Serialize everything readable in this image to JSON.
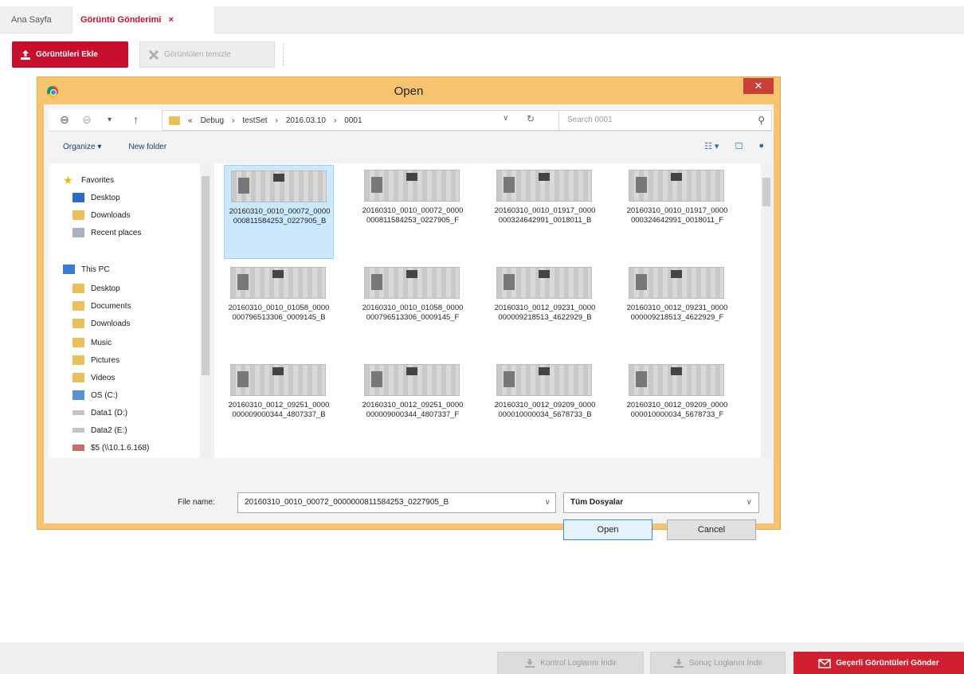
{
  "tabs": [
    {
      "label": "Ana Sayfa"
    },
    {
      "label": "Görüntü Gönderimi",
      "close": "×"
    }
  ],
  "toolbar": {
    "upload_label": "Görüntüleri Ekle",
    "clear_label": "Görüntüleri temizle"
  },
  "dialog": {
    "title": "Open",
    "close": "✕",
    "address": {
      "crumbs": [
        "«",
        "Debug",
        "›",
        "testSet",
        "›",
        "2016.03.10",
        "›",
        "0001"
      ],
      "search_placeholder": "Search 0001"
    },
    "commands": {
      "organize": "Organize ▾",
      "new_folder": "New folder"
    },
    "nav": {
      "items": [
        {
          "label": "Favorites",
          "icon": "star-icon"
        },
        {
          "label": "Desktop",
          "icon": "desktop-icon"
        },
        {
          "label": "Downloads",
          "icon": "downloads-icon"
        },
        {
          "label": "Recent places",
          "icon": "recent-places-icon"
        },
        {
          "label": "This PC",
          "icon": "computer-icon"
        },
        {
          "label": "Desktop",
          "icon": "desktop-folder-icon"
        },
        {
          "label": "Documents",
          "icon": "documents-icon"
        },
        {
          "label": "Downloads",
          "icon": "downloads-folder-icon"
        },
        {
          "label": "Music",
          "icon": "music-icon"
        },
        {
          "label": "Pictures",
          "icon": "pictures-icon"
        },
        {
          "label": "Videos",
          "icon": "videos-icon"
        },
        {
          "label": "OS (C:)",
          "icon": "drive-icon"
        },
        {
          "label": "Data1 (D:)",
          "icon": "drive-icon"
        },
        {
          "label": "Data2 (E:)",
          "icon": "drive-icon"
        },
        {
          "label": "$5 (\\\\10.1.6.168)",
          "icon": "network-drive-icon"
        }
      ]
    },
    "files": [
      {
        "name": "20160310_0010_00072_0000000811584253_0227905_B",
        "selected": true
      },
      {
        "name": "20160310_0010_00072_0000000811584253_0227905_F",
        "selected": false
      },
      {
        "name": "20160310_0010_01917_0000000324642991_0018011_B",
        "selected": false
      },
      {
        "name": "20160310_0010_01917_0000000324642991_0018011_F",
        "selected": false
      },
      {
        "name": "20160310_0010_01058_0000000796513306_0009145_B",
        "selected": false
      },
      {
        "name": "20160310_0010_01058_0000000796513306_0009145_F",
        "selected": false
      },
      {
        "name": "20160310_0012_09231_0000000009218513_4622929_B",
        "selected": false
      },
      {
        "name": "20160310_0012_09231_0000000009218513_4622929_F",
        "selected": false
      },
      {
        "name": "20160310_0012_09251_0000000009000344_4807337_B",
        "selected": false
      },
      {
        "name": "20160310_0012_09251_0000000009000344_4807337_F",
        "selected": false
      },
      {
        "name": "20160310_0012_09209_0000000010000034_5678733_B",
        "selected": false
      },
      {
        "name": "20160310_0012_09209_0000000010000034_5678733_F",
        "selected": false
      }
    ],
    "file_name_label": "File name:",
    "file_name_value": "20160310_0010_00072_0000000811584253_0227905_B",
    "file_type": "Tüm Dosyalar",
    "open_label": "Open",
    "cancel_label": "Cancel"
  },
  "footer": {
    "kontrol_label": "Kontrol Loglarını İndir",
    "sonuc_label": "Sonuç Loglarını İndir",
    "send_label": "Geçerli Görüntüleri Gönder"
  },
  "colors": {
    "accent": "#c8102e",
    "dialog_frame": "#f6c46e"
  }
}
